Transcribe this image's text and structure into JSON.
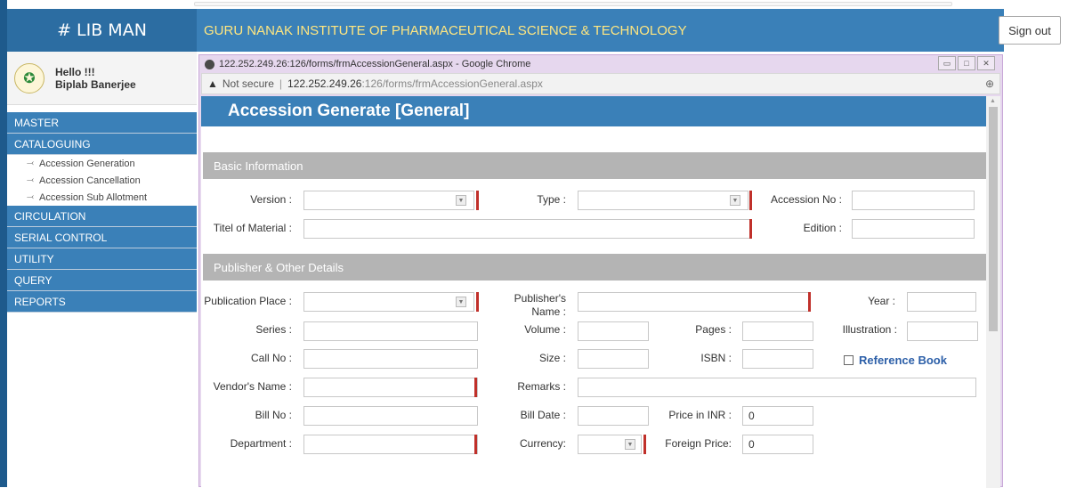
{
  "app": {
    "logo": "# LIB MAN",
    "institute": "GURU NANAK INSTITUTE OF PHARMACEUTICAL SCIENCE & TECHNOLOGY",
    "signout": "Sign out"
  },
  "user": {
    "greeting": "Hello !!!",
    "name": "Biplab Banerjee"
  },
  "sidebar": {
    "items": [
      {
        "label": "MASTER"
      },
      {
        "label": "CATALOGUING"
      },
      {
        "label": "CIRCULATION"
      },
      {
        "label": "SERIAL CONTROL"
      },
      {
        "label": "UTILITY"
      },
      {
        "label": "QUERY"
      },
      {
        "label": "REPORTS"
      }
    ],
    "subitems": [
      {
        "label": "Accession Generation"
      },
      {
        "label": "Accession Cancellation"
      },
      {
        "label": "Accession Sub Allotment"
      }
    ]
  },
  "window": {
    "title": "122.252.249.26:126/forms/frmAccessionGeneral.aspx - Google Chrome",
    "not_secure": "Not secure",
    "url_host": "122.252.249.26",
    "url_rest": ":126/forms/frmAccessionGeneral.aspx"
  },
  "page": {
    "title": "Accession Generate [General]",
    "sections": {
      "basic": "Basic Information",
      "publisher": "Publisher & Other Details"
    },
    "labels": {
      "version": "Version :",
      "type": "Type :",
      "accession_no": "Accession No :",
      "title_material": "Titel of Material :",
      "edition": "Edition :",
      "publication_place": "Publication Place :",
      "publishers_name_1": "Publisher's",
      "publishers_name_2": "Name :",
      "year": "Year :",
      "series": "Series :",
      "volume": "Volume :",
      "pages": "Pages :",
      "illustration": "Illustration :",
      "call_no": "Call No :",
      "size": "Size :",
      "isbn": "ISBN :",
      "reference_book": "Reference Book",
      "vendors_name": "Vendor's Name :",
      "remarks": "Remarks :",
      "bill_no": "Bill No :",
      "bill_date": "Bill Date :",
      "price_inr": "Price in INR :",
      "department": "Department :",
      "currency": "Currency:",
      "foreign_price": "Foreign Price:"
    },
    "values": {
      "price_inr": "0",
      "foreign_price": "0"
    }
  },
  "colors": {
    "header_blue": "#3a80b8",
    "required_red": "#c0302a",
    "institute_text": "#ffe680"
  }
}
